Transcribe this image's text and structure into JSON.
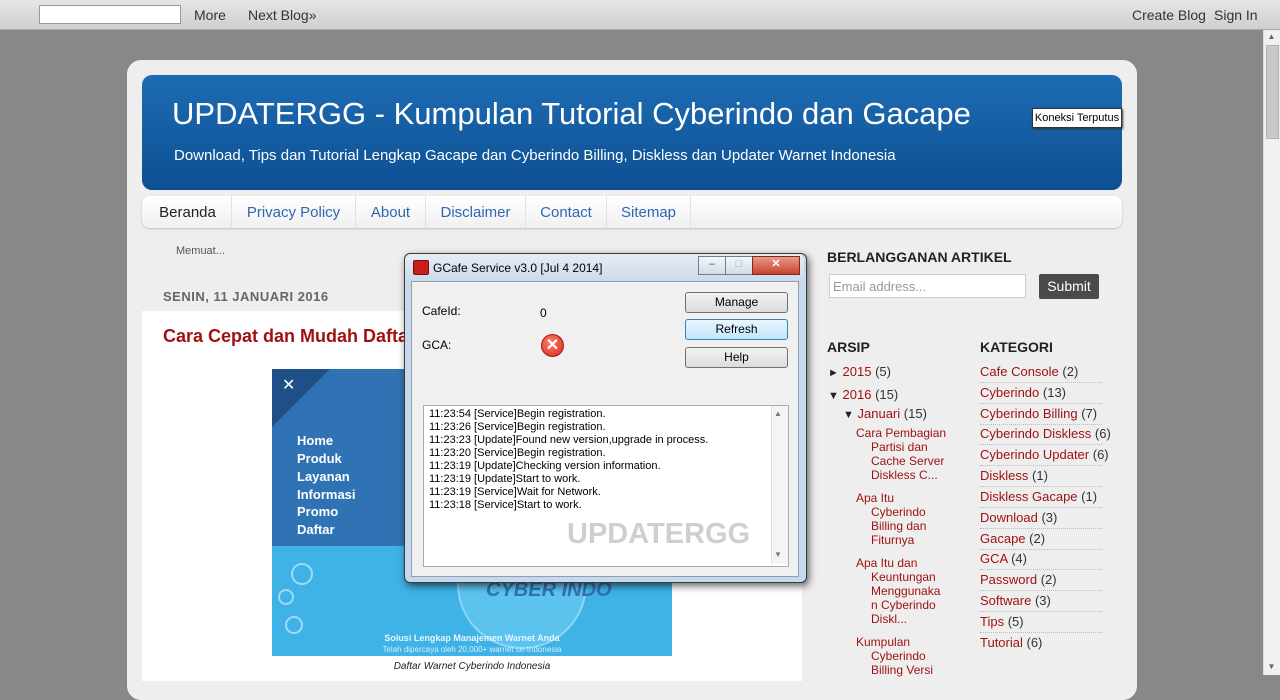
{
  "navbar": {
    "more": "More",
    "next_blog": "Next Blog»",
    "create_blog": "Create Blog",
    "sign_in": "Sign In"
  },
  "header": {
    "title": "UPDATERGG - Kumpulan Tutorial Cyberindo dan Gacape",
    "description": "Download, Tips dan Tutorial Lengkap Gacape dan Cyberindo Billing, Diskless dan Updater Warnet Indonesia",
    "status_badge": "Koneksi Terputus"
  },
  "tabs": [
    "Beranda",
    "Privacy Policy",
    "About",
    "Disclaimer",
    "Contact",
    "Sitemap"
  ],
  "post": {
    "loading": "Memuat...",
    "date": "SENIN, 11 JANUARI 2016",
    "title": "Cara Cepat dan Mudah Dafta",
    "image_menu": [
      "Home",
      "Produk",
      "Layanan",
      "Informasi",
      "Promo",
      "Daftar"
    ],
    "image_logo": "CYBER INDO",
    "image_tagline": "Solusi Lengkap Manajemen Warnet Anda",
    "image_sub": "Telah dipercaya oleh 20.000+ warnet se-Indonesia",
    "caption": "Daftar Warnet Cyberindo Indonesia"
  },
  "sidebar": {
    "subscribe_heading": "BERLANGGANAN ARTIKEL",
    "email_placeholder": "Email address...",
    "submit": "Submit",
    "archive_heading": "ARSIP",
    "archive": {
      "y2015": {
        "toggle": "►",
        "year": "2015",
        "count": "(5)"
      },
      "y2016": {
        "toggle": "▼",
        "year": "2016",
        "count": "(15)"
      },
      "jan": {
        "toggle": "▼",
        "month": "Januari",
        "count": "(15)"
      },
      "posts": [
        [
          "Cara Pembagian",
          "Partisi dan",
          "Cache Server",
          "Diskless C..."
        ],
        [
          "Apa Itu",
          "Cyberindo",
          "Billing dan",
          "Fiturnya"
        ],
        [
          "Apa Itu dan",
          "Keuntungan",
          "Menggunaka",
          "n Cyberindo",
          "Diskl..."
        ],
        [
          "Kumpulan",
          "Cyberindo",
          "Billing Versi"
        ]
      ]
    },
    "category_heading": "KATEGORI",
    "categories": [
      {
        "name": "Cafe Console",
        "count": "(2)"
      },
      {
        "name": "Cyberindo",
        "count": "(13)"
      },
      {
        "name": "Cyberindo Billing",
        "count": "(7)"
      },
      {
        "name": "Cyberindo Diskless",
        "count": "(6)"
      },
      {
        "name": "Cyberindo Updater",
        "count": "(6)"
      },
      {
        "name": "Diskless",
        "count": "(1)"
      },
      {
        "name": "Diskless Gacape",
        "count": "(1)"
      },
      {
        "name": "Download",
        "count": "(3)"
      },
      {
        "name": "Gacape",
        "count": "(2)"
      },
      {
        "name": "GCA",
        "count": "(4)"
      },
      {
        "name": "Password",
        "count": "(2)"
      },
      {
        "name": "Software",
        "count": "(3)"
      },
      {
        "name": "Tips",
        "count": "(5)"
      },
      {
        "name": "Tutorial",
        "count": "(6)"
      }
    ]
  },
  "dialog": {
    "title": "GCafe Service v3.0 [Jul  4 2014]",
    "cafeid_label": "CafeId:",
    "cafeid_value": "0",
    "gca_label": "GCA:",
    "gca_status_icon": "error-icon",
    "buttons": {
      "manage": "Manage",
      "refresh": "Refresh",
      "help": "Help"
    },
    "log": [
      "11:23:54 [Service]Begin registration.",
      "11:23:26 [Service]Begin registration.",
      "11:23:23 [Update]Found new version,upgrade in process.",
      "11:23:20 [Service]Begin registration.",
      "11:23:19 [Update]Checking version information.",
      "11:23:19 [Update]Start to work.",
      "11:23:19 [Service]Wait for Network.",
      "11:23:18 [Service]Start to work."
    ],
    "watermark": "UPDATERGG"
  },
  "colors": {
    "header_blue": "#1a63ab",
    "link_red": "#a01212",
    "tab_link": "#2d67b1"
  }
}
